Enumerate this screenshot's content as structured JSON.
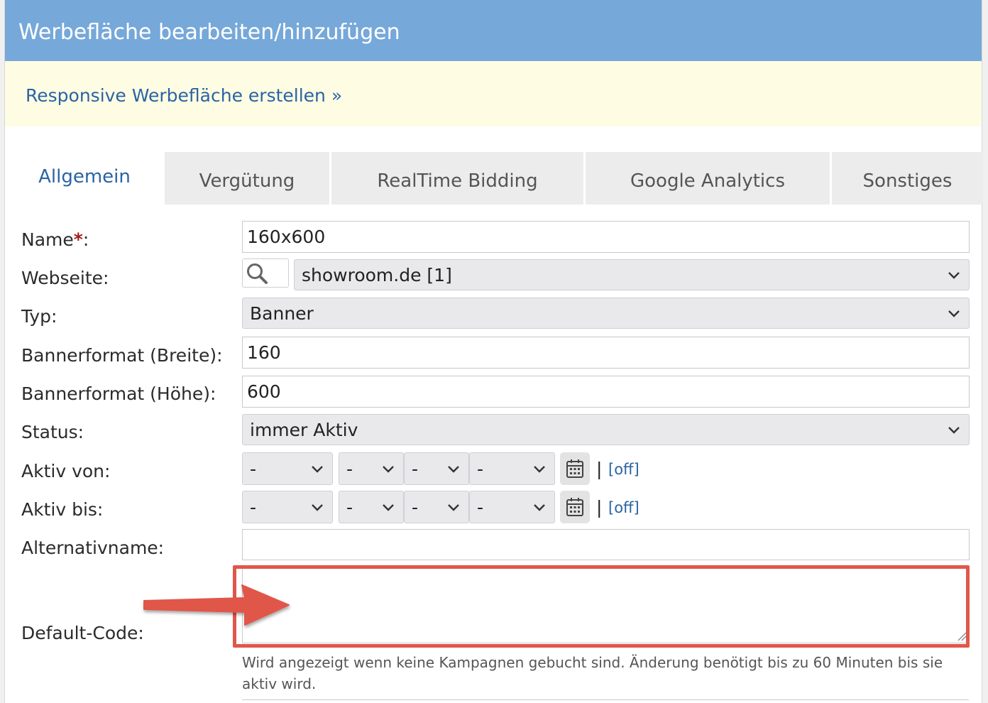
{
  "header": {
    "title": "Werbefläche bearbeiten/hinzufügen"
  },
  "notice": {
    "link": "Responsive Werbefläche erstellen »"
  },
  "tabs": [
    {
      "label": "Allgemein",
      "active": true
    },
    {
      "label": "Vergütung"
    },
    {
      "label": "RealTime Bidding"
    },
    {
      "label": "Google Analytics"
    },
    {
      "label": "Sonstiges"
    }
  ],
  "form": {
    "name": {
      "label": "Name",
      "required_mark": "*",
      "colon": ":",
      "value": "160x600"
    },
    "website": {
      "label": "Webseite:",
      "value": "showroom.de [1]"
    },
    "type": {
      "label": "Typ:",
      "value": "Banner"
    },
    "width": {
      "label": "Bannerformat (Breite):",
      "value": "160"
    },
    "height": {
      "label": "Bannerformat (Höhe):",
      "value": "600"
    },
    "status": {
      "label": "Status:",
      "value": "immer Aktiv"
    },
    "active_from": {
      "label": "Aktiv von:",
      "day": "-",
      "month": "-",
      "year": "-",
      "time": "-",
      "separator": "|",
      "off_link": "[off]"
    },
    "active_to": {
      "label": "Aktiv bis:",
      "day": "-",
      "month": "-",
      "year": "-",
      "time": "-",
      "separator": "|",
      "off_link": "[off]"
    },
    "alt_name": {
      "label": "Alternativname:",
      "value": ""
    },
    "default_code": {
      "label": "Default-Code:",
      "value": "",
      "help": "Wird angezeigt wenn keine Kampagnen gebucht sind. Änderung benötigt bis zu 60 Minuten bis sie aktiv wird."
    }
  },
  "colors": {
    "header_bg": "#76a8d9",
    "notice_bg": "#fefde3",
    "link": "#2a63a4",
    "highlight": "#e0574a"
  }
}
